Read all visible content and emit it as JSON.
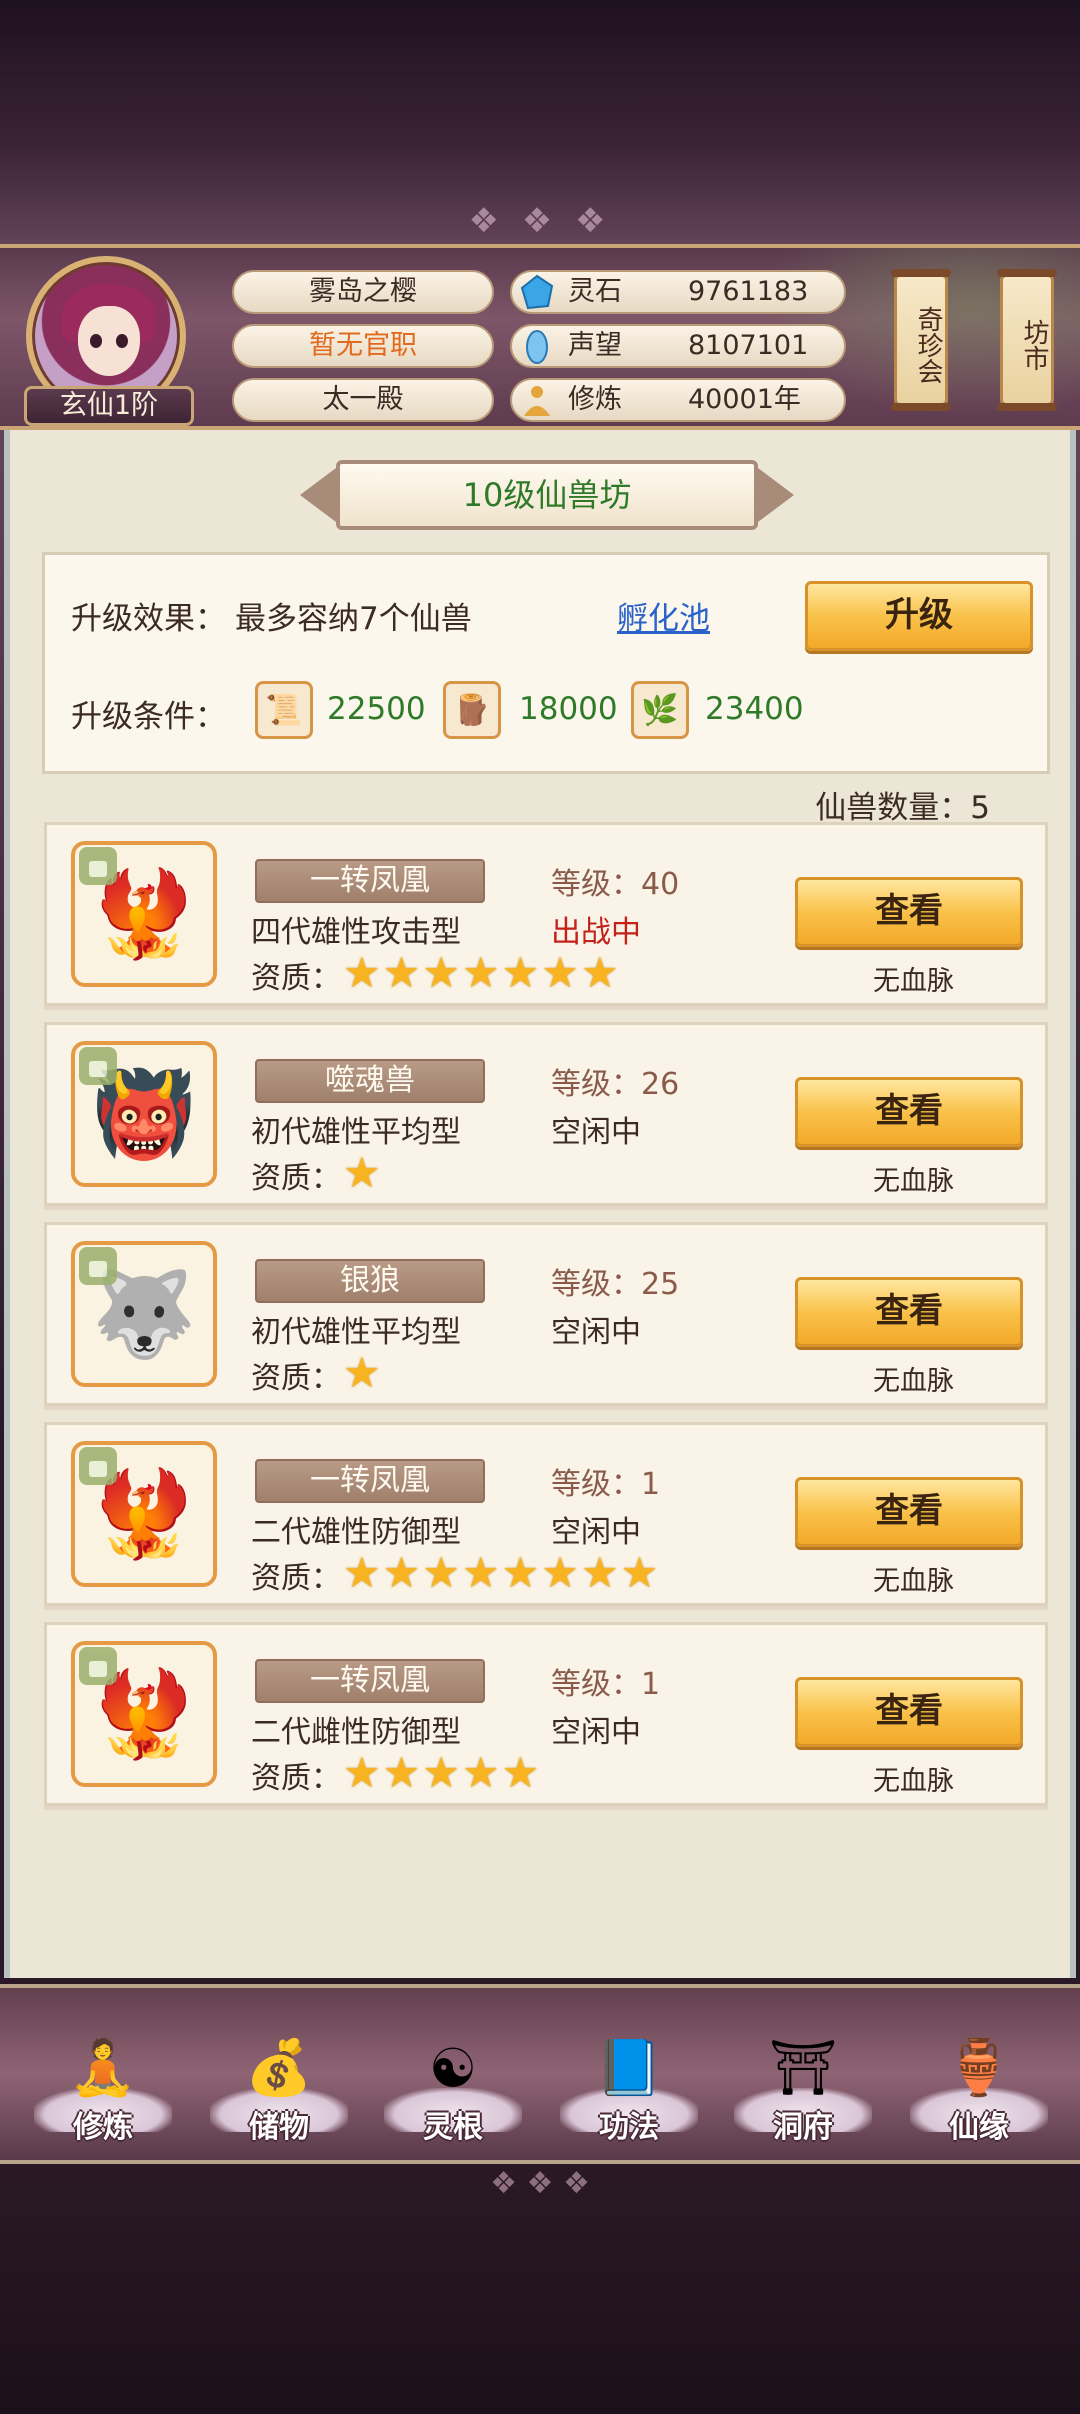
{
  "header": {
    "rank_badge": "玄仙1阶",
    "name": "雾岛之樱",
    "official_title": "暂无官职",
    "hall": "太一殿",
    "resources": [
      {
        "icon": "spirit-stone-icon",
        "label": "灵石",
        "value": "9761183"
      },
      {
        "icon": "reputation-icon",
        "label": "声望",
        "value": "8107101"
      },
      {
        "icon": "cultivation-icon",
        "label": "修炼",
        "value": "40001年"
      }
    ],
    "side_buttons": [
      "奇珍会",
      "坊市"
    ]
  },
  "panel": {
    "title": "10级仙兽坊",
    "upgrade_effect_label": "升级效果：",
    "upgrade_effect_value": "最多容纳7个仙兽",
    "hatch_link": "孵化池",
    "upgrade_button": "升级",
    "upgrade_cond_label": "升级条件：",
    "costs": [
      {
        "icon": "scroll-material-icon",
        "value": "22500"
      },
      {
        "icon": "wood-material-icon",
        "value": "18000"
      },
      {
        "icon": "herb-material-icon",
        "value": "23400"
      }
    ],
    "beast_count": "仙兽数量：5"
  },
  "beasts": [
    {
      "name": "一转凤凰",
      "desc": "四代雄性攻击型",
      "level": "等级：40",
      "status": "出战中",
      "stars": 7,
      "bloodline": "无血脉",
      "view": "查看",
      "quality_label": "资质：",
      "icon": "phoenix-icon"
    },
    {
      "name": "噬魂兽",
      "desc": "初代雄性平均型",
      "level": "等级：26",
      "status": "空闲中",
      "stars": 1,
      "bloodline": "无血脉",
      "view": "查看",
      "quality_label": "资质：",
      "icon": "soul-beast-icon"
    },
    {
      "name": "银狼",
      "desc": "初代雄性平均型",
      "level": "等级：25",
      "status": "空闲中",
      "stars": 1,
      "bloodline": "无血脉",
      "view": "查看",
      "quality_label": "资质：",
      "icon": "silver-wolf-icon"
    },
    {
      "name": "一转凤凰",
      "desc": "二代雄性防御型",
      "level": "等级：1",
      "status": "空闲中",
      "stars": 8,
      "bloodline": "无血脉",
      "view": "查看",
      "quality_label": "资质：",
      "icon": "phoenix-icon"
    },
    {
      "name": "一转凤凰",
      "desc": "二代雌性防御型",
      "level": "等级：1",
      "status": "空闲中",
      "stars": 5,
      "bloodline": "无血脉",
      "view": "查看",
      "quality_label": "资质：",
      "icon": "phoenix-icon"
    }
  ],
  "nav": [
    {
      "label": "修炼",
      "icon": "monk-icon"
    },
    {
      "label": "储物",
      "icon": "storage-bag-icon"
    },
    {
      "label": "灵根",
      "icon": "spirit-root-icon"
    },
    {
      "label": "功法",
      "icon": "book-icon"
    },
    {
      "label": "洞府",
      "icon": "cave-palace-icon"
    },
    {
      "label": "仙缘",
      "icon": "gourd-icon"
    }
  ],
  "colors": {
    "accent_gold": "#f9c24a",
    "status_red": "#c4211b",
    "cost_green": "#2f7a28",
    "link_blue": "#2a62c9"
  }
}
